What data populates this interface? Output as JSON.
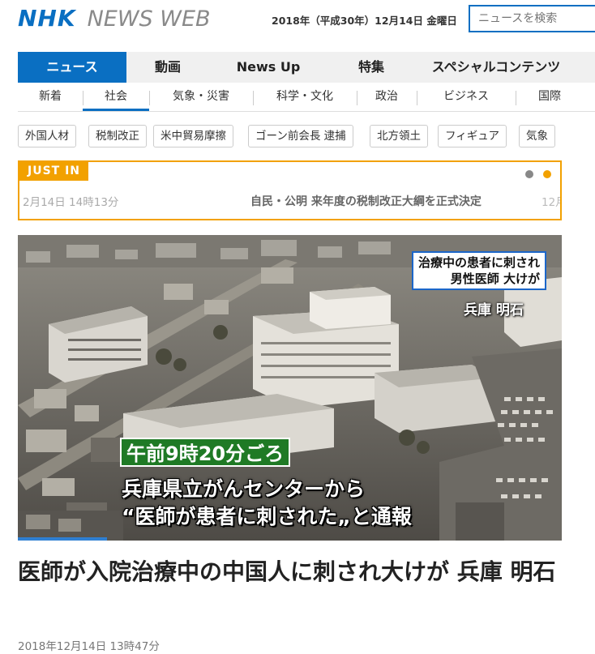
{
  "header": {
    "logo_nhk": "NHK",
    "logo_news": "NEWS WEB",
    "date": "2018年（平成30年）12月14日 金曜日",
    "search_placeholder": "ニュースを検索"
  },
  "main_nav": [
    {
      "label": "ニュース",
      "active": true
    },
    {
      "label": "動画",
      "active": false
    },
    {
      "label": "News Up",
      "active": false
    },
    {
      "label": "特集",
      "active": false
    },
    {
      "label": "スペシャルコンテンツ",
      "active": false
    }
  ],
  "sub_nav": [
    {
      "label": "新着",
      "active": false
    },
    {
      "label": "社会",
      "active": true
    },
    {
      "label": "気象・災害",
      "active": false
    },
    {
      "label": "科学・文化",
      "active": false
    },
    {
      "label": "政治",
      "active": false
    },
    {
      "label": "ビジネス",
      "active": false
    },
    {
      "label": "国際",
      "active": false
    }
  ],
  "tags": [
    "外国人材",
    "税制改正",
    "米中貿易摩擦",
    "ゴーン前会長 逮捕",
    "北方領土",
    "フィギュア",
    "気象"
  ],
  "just_in": {
    "label": "JUST IN",
    "time": "2月14日 14時13分",
    "headline": "自民・公明 来年度の税制改正大綱を正式決定",
    "next_time": "12月"
  },
  "hero": {
    "caption_line1": "治療中の患者に刺され",
    "caption_line2": "男性医師 大けが",
    "location": "兵庫 明石",
    "telop_time": "午前9時20分ごろ",
    "telop_line1": "兵庫県立がんセンターから",
    "telop_line2": "“医師が患者に刺された„と通報"
  },
  "article": {
    "headline": "医師が入院治療中の中国人に刺され大けが 兵庫 明石",
    "date": "2018年12月14日 13時47分"
  },
  "colors": {
    "brand_blue": "#0a6fc2",
    "just_in_orange": "#f2a100",
    "telop_green": "#1f7a25"
  }
}
